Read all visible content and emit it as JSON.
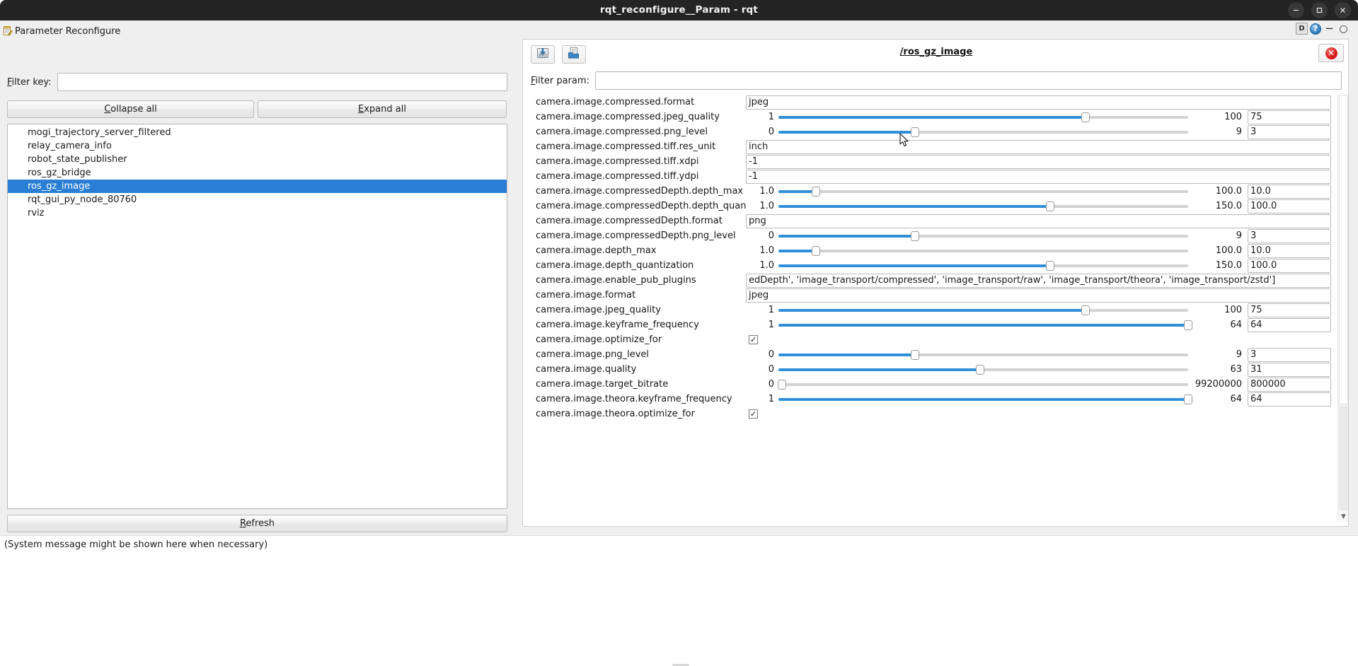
{
  "window": {
    "title": "rqt_reconfigure__Param - rqt",
    "controls": [
      {
        "name": "minimize",
        "glyph": "—"
      },
      {
        "name": "maximize",
        "glyph": "□"
      },
      {
        "name": "close",
        "glyph": "✕"
      }
    ]
  },
  "left_dock": {
    "title": "Parameter Reconfigure",
    "icon": "note-edit-icon",
    "filter": {
      "label": "Filter key:",
      "label_mnemonic": "F",
      "value": "",
      "placeholder": ""
    },
    "collapse_all_label": "Collapse all",
    "collapse_all_mnemonic": "C",
    "expand_all_label": "Expand all",
    "expand_all_mnemonic": "E",
    "refresh_label": "Refresh",
    "refresh_mnemonic": "R",
    "tree_items": [
      {
        "label": "mogi_trajectory_server_filtered",
        "selected": false
      },
      {
        "label": "relay_camera_info",
        "selected": false
      },
      {
        "label": "robot_state_publisher",
        "selected": false
      },
      {
        "label": "ros_gz_bridge",
        "selected": false
      },
      {
        "label": "ros_gz_image",
        "selected": true
      },
      {
        "label": "rqt_gui_py_node_80760",
        "selected": false
      },
      {
        "label": "rviz",
        "selected": false
      }
    ]
  },
  "status_bar": {
    "message": "(System message might be shown here when necessary)"
  },
  "right_dock": {
    "header_buttons": [
      {
        "name": "dock-float-button",
        "glyph": "D"
      },
      {
        "name": "help-button",
        "glyph": "?"
      },
      {
        "name": "dock-minimize-button",
        "glyph": "−"
      },
      {
        "name": "dock-restore-button",
        "glyph": "○"
      }
    ],
    "toolbar": {
      "save_icon": "save-floppy-icon",
      "load_icon": "open-folder-icon",
      "close_icon": "close-circle-icon"
    },
    "node_name": "/ros_gz_image",
    "filter_param": {
      "label": "Filter param:",
      "label_mnemonic": "F",
      "value": "",
      "placeholder": ""
    },
    "scrollbar": {
      "down_arrow": "▼"
    }
  },
  "params": [
    {
      "name": "camera.image.compressed.format",
      "type": "text",
      "value": "jpeg"
    },
    {
      "name": "camera.image.compressed.jpeg_quality",
      "type": "slider",
      "min": "1",
      "max": "100",
      "value": "75",
      "pct": 75
    },
    {
      "name": "camera.image.compressed.png_level",
      "type": "slider",
      "min": "0",
      "max": "9",
      "value": "3",
      "pct": 33.3
    },
    {
      "name": "camera.image.compressed.tiff.res_unit",
      "type": "text",
      "value": "inch"
    },
    {
      "name": "camera.image.compressed.tiff.xdpi",
      "type": "text",
      "value": "-1"
    },
    {
      "name": "camera.image.compressed.tiff.ydpi",
      "type": "text",
      "value": "-1"
    },
    {
      "name": "camera.image.compressedDepth.depth_max",
      "type": "slider",
      "min": "1.0",
      "max": "100.0",
      "value": "10.0",
      "pct": 9.1
    },
    {
      "name": "camera.image.compressedDepth.depth_quantization",
      "type": "slider",
      "min": "1.0",
      "max": "150.0",
      "value": "100.0",
      "pct": 66.4
    },
    {
      "name": "camera.image.compressedDepth.format",
      "type": "text",
      "value": "png"
    },
    {
      "name": "camera.image.compressedDepth.png_level",
      "type": "slider",
      "min": "0",
      "max": "9",
      "value": "3",
      "pct": 33.3
    },
    {
      "name": "camera.image.depth_max",
      "type": "slider",
      "min": "1.0",
      "max": "100.0",
      "value": "10.0",
      "pct": 9.1
    },
    {
      "name": "camera.image.depth_quantization",
      "type": "slider",
      "min": "1.0",
      "max": "150.0",
      "value": "100.0",
      "pct": 66.4
    },
    {
      "name": "camera.image.enable_pub_plugins",
      "type": "text",
      "value": "edDepth', 'image_transport/compressed', 'image_transport/raw', 'image_transport/theora', 'image_transport/zstd']"
    },
    {
      "name": "camera.image.format",
      "type": "text",
      "value": "jpeg"
    },
    {
      "name": "camera.image.jpeg_quality",
      "type": "slider",
      "min": "1",
      "max": "100",
      "value": "75",
      "pct": 75
    },
    {
      "name": "camera.image.keyframe_frequency",
      "type": "slider",
      "min": "1",
      "max": "64",
      "value": "64",
      "pct": 100
    },
    {
      "name": "camera.image.optimize_for",
      "type": "checkbox",
      "checked": true,
      "glyph": "✓"
    },
    {
      "name": "camera.image.png_level",
      "type": "slider",
      "min": "0",
      "max": "9",
      "value": "3",
      "pct": 33.3
    },
    {
      "name": "camera.image.quality",
      "type": "slider",
      "min": "0",
      "max": "63",
      "value": "31",
      "pct": 49.2
    },
    {
      "name": "camera.image.target_bitrate",
      "type": "slider",
      "min": "0",
      "max": "99200000",
      "value": "800000",
      "pct": 0.8
    },
    {
      "name": "camera.image.theora.keyframe_frequency",
      "type": "slider",
      "min": "1",
      "max": "64",
      "value": "64",
      "pct": 100
    },
    {
      "name": "camera.image.theora.optimize_for",
      "type": "checkbox",
      "checked": true,
      "glyph": "✓"
    }
  ]
}
